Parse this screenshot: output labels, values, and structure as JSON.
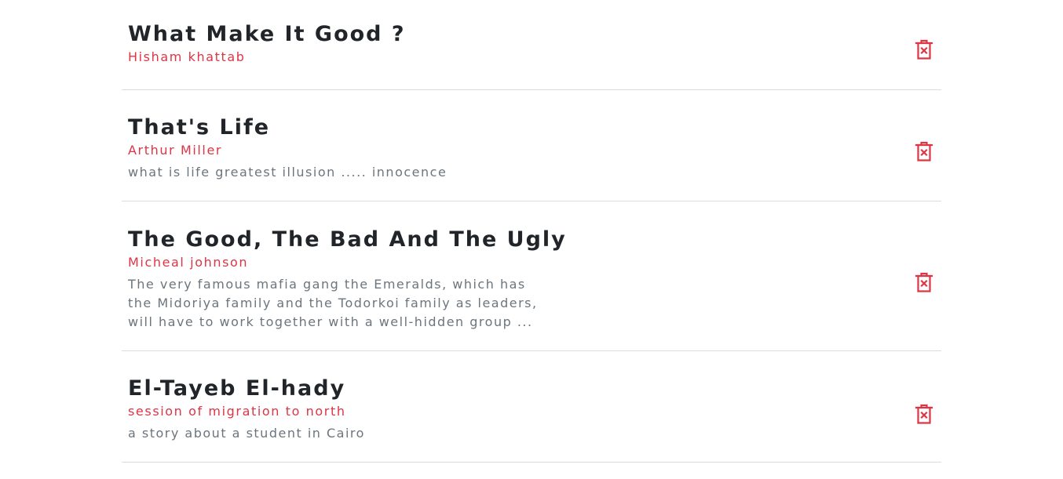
{
  "colors": {
    "title": "#212529",
    "accent": "#dc3545",
    "muted": "#6c757d",
    "divider": "#dcdcdc"
  },
  "stories": [
    {
      "title": "What Make It Good ?",
      "author": "Hisham khattab",
      "description": "",
      "delete_icon": "trash-x-icon"
    },
    {
      "title": "That's Life",
      "author": "Arthur Miller",
      "description": "what is life greatest illusion ..... innocence",
      "delete_icon": "trash-x-icon"
    },
    {
      "title": "The Good, The Bad And The Ugly",
      "author": "Micheal johnson",
      "description": "The very famous mafia gang the Emeralds, which has the Midoriya family and the Todorkoi family as leaders, will have to work together with a well-hidden group ...",
      "delete_icon": "trash-x-icon"
    },
    {
      "title": "El-Tayeb El-hady",
      "author": "session of migration to north",
      "description": "a story about a student in Cairo",
      "delete_icon": "trash-x-icon"
    }
  ]
}
